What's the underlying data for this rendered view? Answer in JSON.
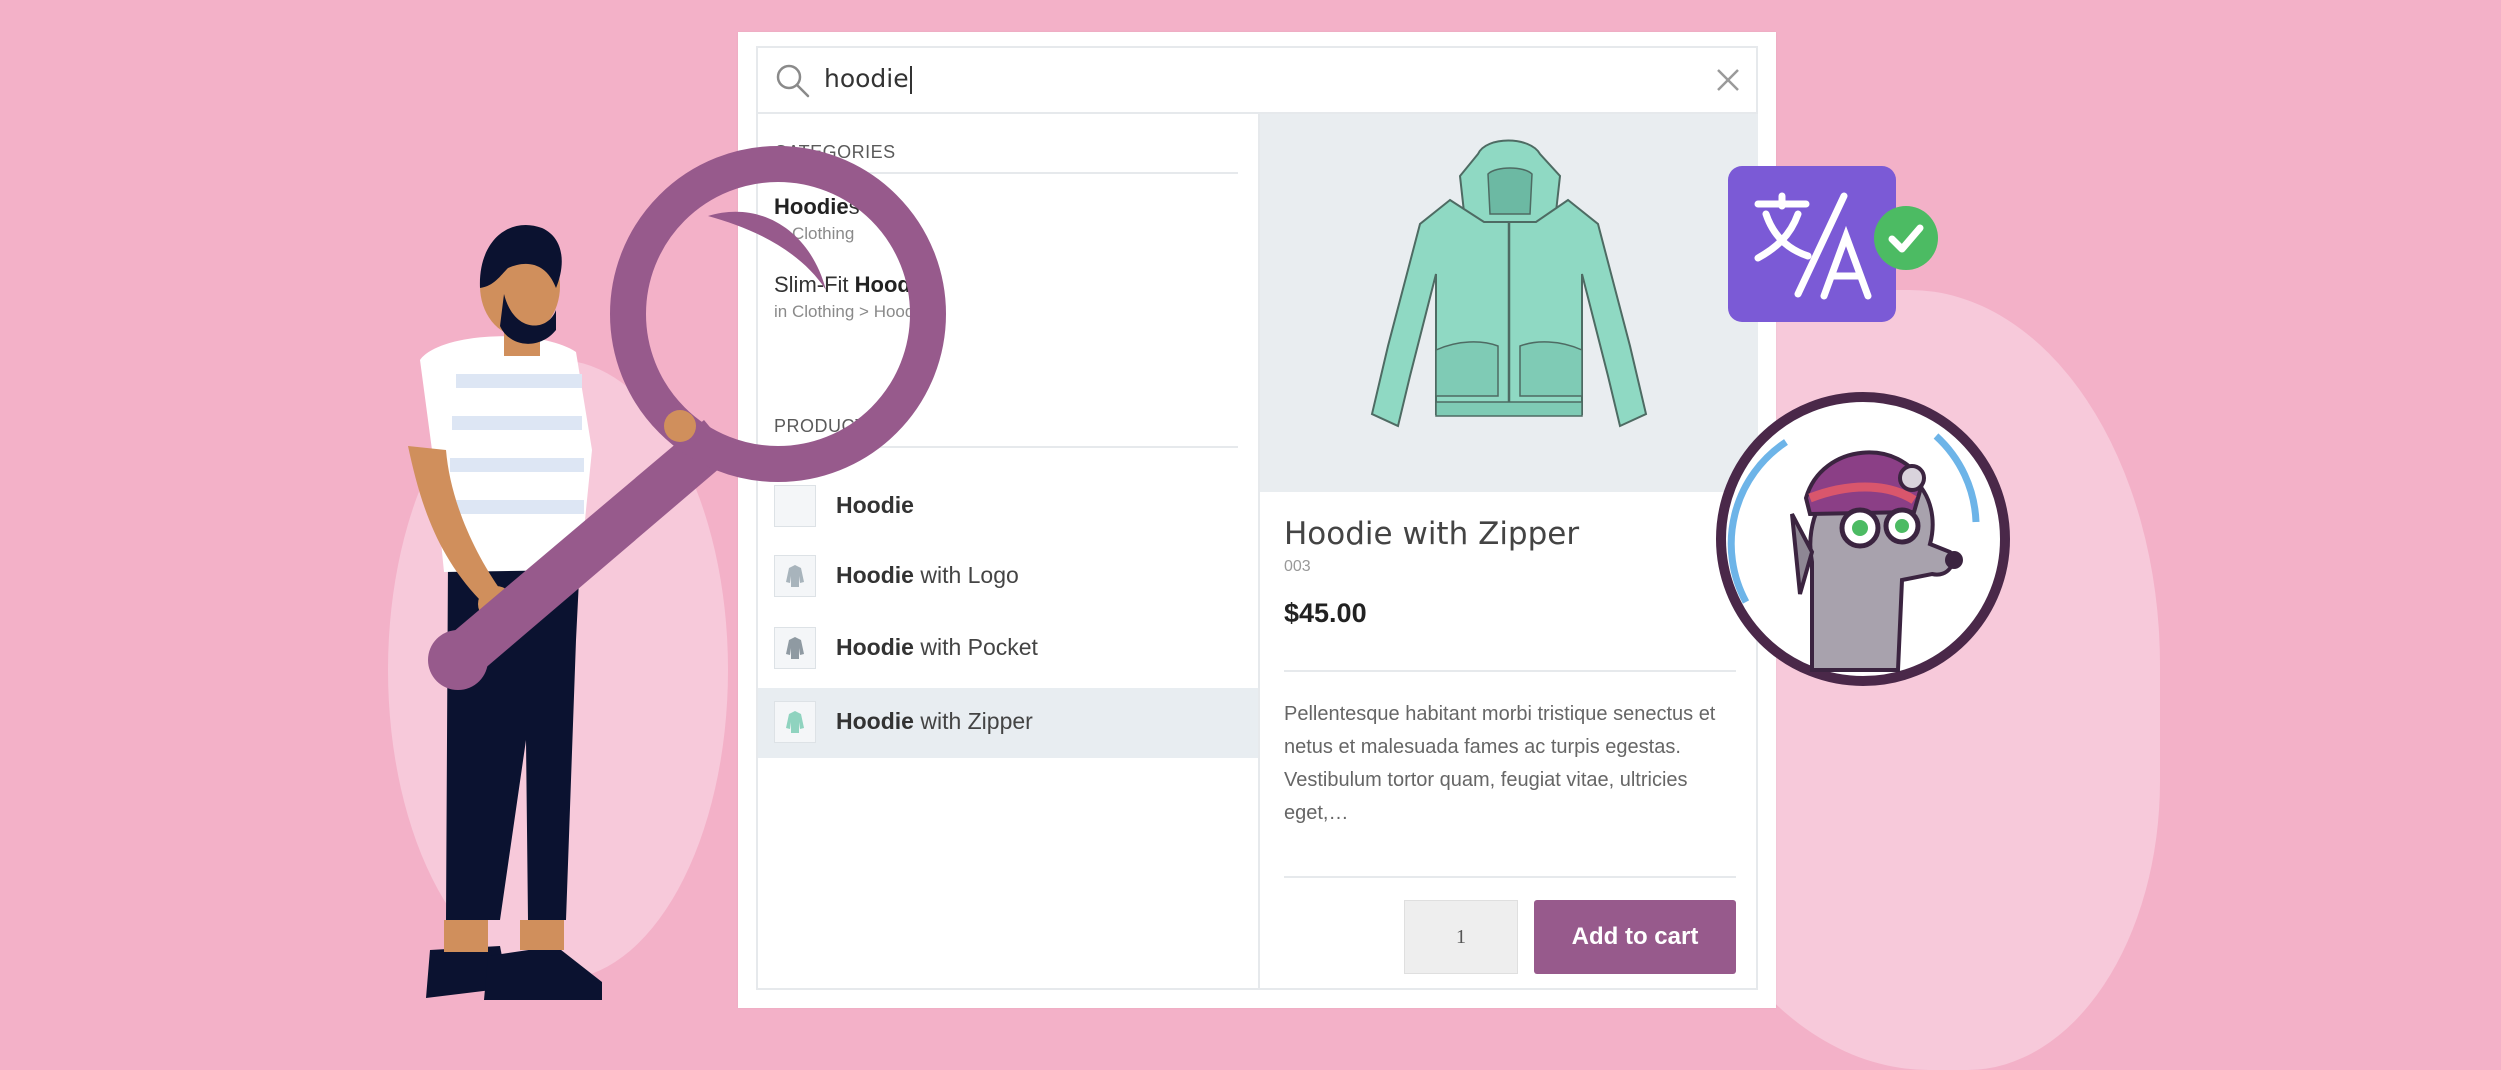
{
  "search": {
    "query": "hoodie"
  },
  "categories": {
    "heading": "CATEGORIES",
    "items": [
      {
        "match": "Hoodie",
        "rest": "s",
        "prefix": "",
        "path": "in Clothing"
      },
      {
        "prefix": "Slim-Fit ",
        "match": "Hoodie",
        "rest": "s",
        "path": "in Clothing > Hoodies"
      }
    ]
  },
  "products": {
    "heading": "PRODUCTS",
    "items": [
      {
        "match": "Hoodie",
        "rest": ""
      },
      {
        "match": "Hoodie",
        "rest": " with Logo"
      },
      {
        "match": "Hoodie",
        "rest": " with Pocket"
      },
      {
        "match": "Hoodie",
        "rest": " with Zipper"
      }
    ]
  },
  "detail": {
    "name": "Hoodie with Zipper",
    "sku": "003",
    "price": "$45.00",
    "description": "Pellentesque habitant morbi tristique senectus et netus et malesuada fames ac turpis egestas. Vestibulum tortor quam, feugiat vitae, ultricies eget,…",
    "quantity": "1",
    "add_to_cart": "Add to cart"
  },
  "colors": {
    "background": "#f3b1c8",
    "accent": "#975a8c",
    "translate_badge": "#7b5ad6",
    "check": "#4cbb63"
  }
}
